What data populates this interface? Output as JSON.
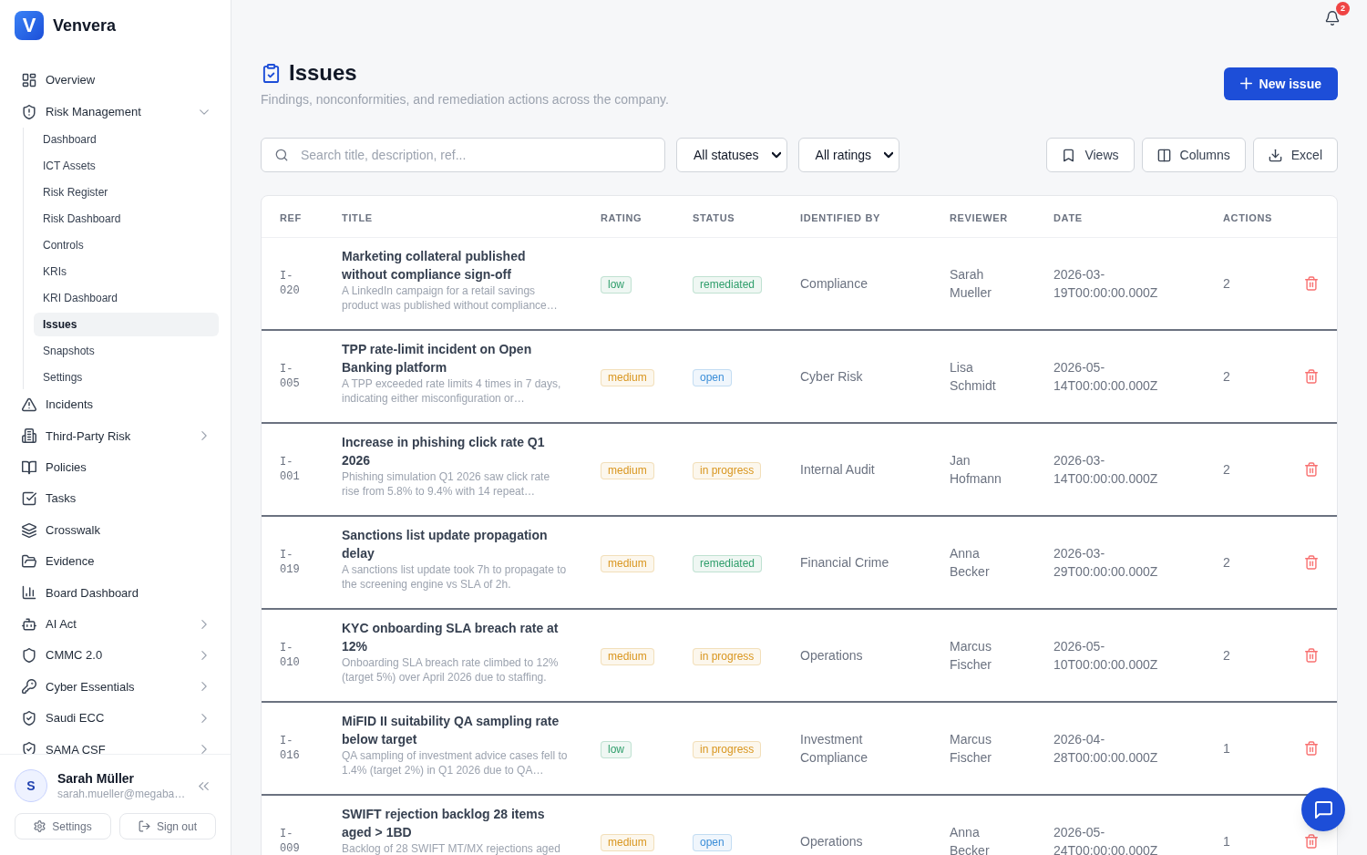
{
  "sidebar": {
    "logo": "V",
    "brand": "Venvera",
    "items": [
      {
        "label": "Overview",
        "selected": false
      },
      {
        "label": "Risk Management",
        "selected": false,
        "expanded": true,
        "children": [
          {
            "label": "Dashboard",
            "selected": false
          },
          {
            "label": "ICT Assets",
            "selected": false
          },
          {
            "label": "Risk Register",
            "selected": false
          },
          {
            "label": "Risk Dashboard",
            "selected": false
          },
          {
            "label": "Controls",
            "selected": false
          },
          {
            "label": "KRIs",
            "selected": false
          },
          {
            "label": "KRI Dashboard",
            "selected": false
          },
          {
            "label": "Issues",
            "selected": true
          },
          {
            "label": "Snapshots",
            "selected": false
          },
          {
            "label": "Settings",
            "selected": false
          }
        ]
      },
      {
        "label": "Incidents",
        "selected": false
      },
      {
        "label": "Third-Party Risk",
        "selected": false,
        "expanded": false
      },
      {
        "label": "Policies",
        "selected": false
      },
      {
        "label": "Tasks",
        "selected": false
      },
      {
        "label": "Crosswalk",
        "selected": false
      },
      {
        "label": "Evidence",
        "selected": false
      },
      {
        "label": "Board Dashboard",
        "selected": false
      },
      {
        "label": "AI Act",
        "selected": false,
        "expanded": false
      },
      {
        "label": "CMMC 2.0",
        "selected": false,
        "expanded": false
      },
      {
        "label": "Cyber Essentials",
        "selected": false,
        "expanded": false
      },
      {
        "label": "Saudi ECC",
        "selected": false,
        "expanded": false
      },
      {
        "label": "SAMA CSF",
        "selected": false,
        "expanded": false
      }
    ],
    "user": {
      "initial": "S",
      "name": "Sarah Müller",
      "email": "sarah.mueller@megaba…"
    },
    "footer_buttons": [
      "Settings",
      "Sign out"
    ]
  },
  "topbar": {
    "notification_count": "2"
  },
  "header": {
    "title": "Issues",
    "subtitle": "Findings, nonconformities, and remediation actions across the company.",
    "new_button": "New issue"
  },
  "toolbar": {
    "search": {
      "placeholder": "Search title, description, ref..."
    },
    "filters": [
      "All statuses",
      "All ratings"
    ],
    "buttons": [
      "Views",
      "Columns",
      "Excel"
    ]
  },
  "table": {
    "columns": [
      "REF",
      "TITLE",
      "RATING",
      "STATUS",
      "IDENTIFIED BY",
      "REVIEWER",
      "DATE",
      "ACTIONS"
    ],
    "rows": [
      {
        "ref": "I-020",
        "title": "Marketing collateral published without compliance sign-off",
        "description": "A LinkedIn campaign for a retail savings product was published without compliance…",
        "rating": {
          "label": "low",
          "color": "#2f9e6b"
        },
        "status": {
          "label": "remediated",
          "color": "#2f9e6b"
        },
        "identified_by": "Compliance",
        "reviewer": "Sarah Mueller",
        "date": "2026-03-19T00:00:00.000Z",
        "actions": "2"
      },
      {
        "ref": "I-005",
        "title": "TPP rate-limit incident on Open Banking platform",
        "description": "A TPP exceeded rate limits 4 times in 7 days, indicating either misconfiguration or…",
        "rating": {
          "label": "medium",
          "color": "#d9961f"
        },
        "status": {
          "label": "open",
          "color": "#3b8ed8"
        },
        "identified_by": "Cyber Risk",
        "reviewer": "Lisa Schmidt",
        "date": "2026-05-14T00:00:00.000Z",
        "actions": "2"
      },
      {
        "ref": "I-001",
        "title": "Increase in phishing click rate Q1 2026",
        "description": "Phishing simulation Q1 2026 saw click rate rise from 5.8% to 9.4% with 14 repeat…",
        "rating": {
          "label": "medium",
          "color": "#d9961f"
        },
        "status": {
          "label": "in progress",
          "color": "#d9961f"
        },
        "identified_by": "Internal Audit",
        "reviewer": "Jan Hofmann",
        "date": "2026-03-14T00:00:00.000Z",
        "actions": "2"
      },
      {
        "ref": "I-019",
        "title": "Sanctions list update propagation delay",
        "description": "A sanctions list update took 7h to propagate to the screening engine vs SLA of 2h.",
        "rating": {
          "label": "medium",
          "color": "#d9961f"
        },
        "status": {
          "label": "remediated",
          "color": "#2f9e6b"
        },
        "identified_by": "Financial Crime",
        "reviewer": "Anna Becker",
        "date": "2026-03-29T00:00:00.000Z",
        "actions": "2"
      },
      {
        "ref": "I-010",
        "title": "KYC onboarding SLA breach rate at 12%",
        "description": "Onboarding SLA breach rate climbed to 12% (target 5%) over April 2026 due to staffing.",
        "rating": {
          "label": "medium",
          "color": "#d9961f"
        },
        "status": {
          "label": "in progress",
          "color": "#d9961f"
        },
        "identified_by": "Operations",
        "reviewer": "Marcus Fischer",
        "date": "2026-05-10T00:00:00.000Z",
        "actions": "2"
      },
      {
        "ref": "I-016",
        "title": "MiFID II suitability QA sampling rate below target",
        "description": "QA sampling of investment advice cases fell to 1.4% (target 2%) in Q1 2026 due to QA…",
        "rating": {
          "label": "low",
          "color": "#2f9e6b"
        },
        "status": {
          "label": "in progress",
          "color": "#d9961f"
        },
        "identified_by": "Investment Compliance",
        "reviewer": "Marcus Fischer",
        "date": "2026-04-28T00:00:00.000Z",
        "actions": "1"
      },
      {
        "ref": "I-009",
        "title": "SWIFT rejection backlog 28 items aged > 1BD",
        "description": "Backlog of 28 SWIFT MT/MX rejections aged",
        "rating": {
          "label": "medium",
          "color": "#d9961f"
        },
        "status": {
          "label": "open",
          "color": "#3b8ed8"
        },
        "identified_by": "Operations",
        "reviewer": "Anna Becker",
        "date": "2026-05-24T00:00:00.000Z",
        "actions": "1"
      }
    ]
  }
}
